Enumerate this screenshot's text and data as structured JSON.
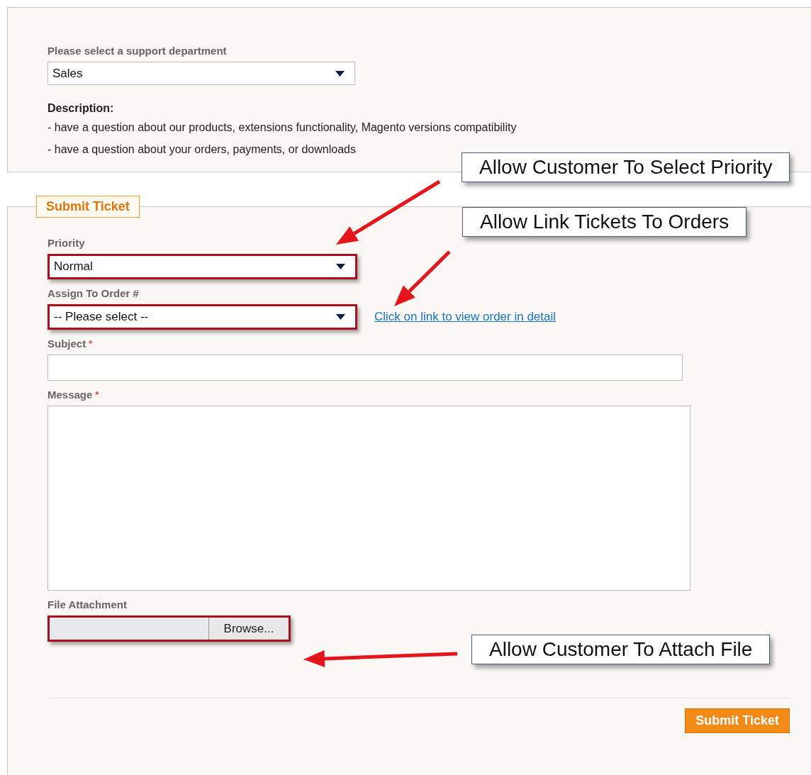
{
  "department": {
    "label": "Please select a support department",
    "value": "Sales"
  },
  "description": {
    "title": "Description:",
    "lines": [
      "- have a question about our products, extensions functionality, Magento versions compatibility",
      "- have a question about your orders, payments, or downloads"
    ]
  },
  "form": {
    "legend": "Submit Ticket",
    "fields": [
      {
        "kind": "select",
        "label": "Priority",
        "value": "Normal",
        "highlighted": true
      },
      {
        "kind": "select",
        "label": "Assign To Order #",
        "value": "-- Please select --",
        "highlighted": true,
        "link": "Click on link to view order in detail"
      },
      {
        "kind": "text",
        "label": "Subject",
        "required_mark": "*",
        "highlighted": false
      },
      {
        "kind": "textarea",
        "label": "Message",
        "required_mark": "*",
        "highlighted": false
      },
      {
        "kind": "file",
        "label": "File Attachment",
        "button": "Browse...",
        "highlighted": true
      }
    ],
    "submit": "Submit Ticket"
  },
  "callouts": [
    {
      "text": "Allow Customer To Select Priority"
    },
    {
      "text": "Allow Link Tickets To Orders"
    },
    {
      "text": "Allow Customer To Attach File"
    }
  ]
}
